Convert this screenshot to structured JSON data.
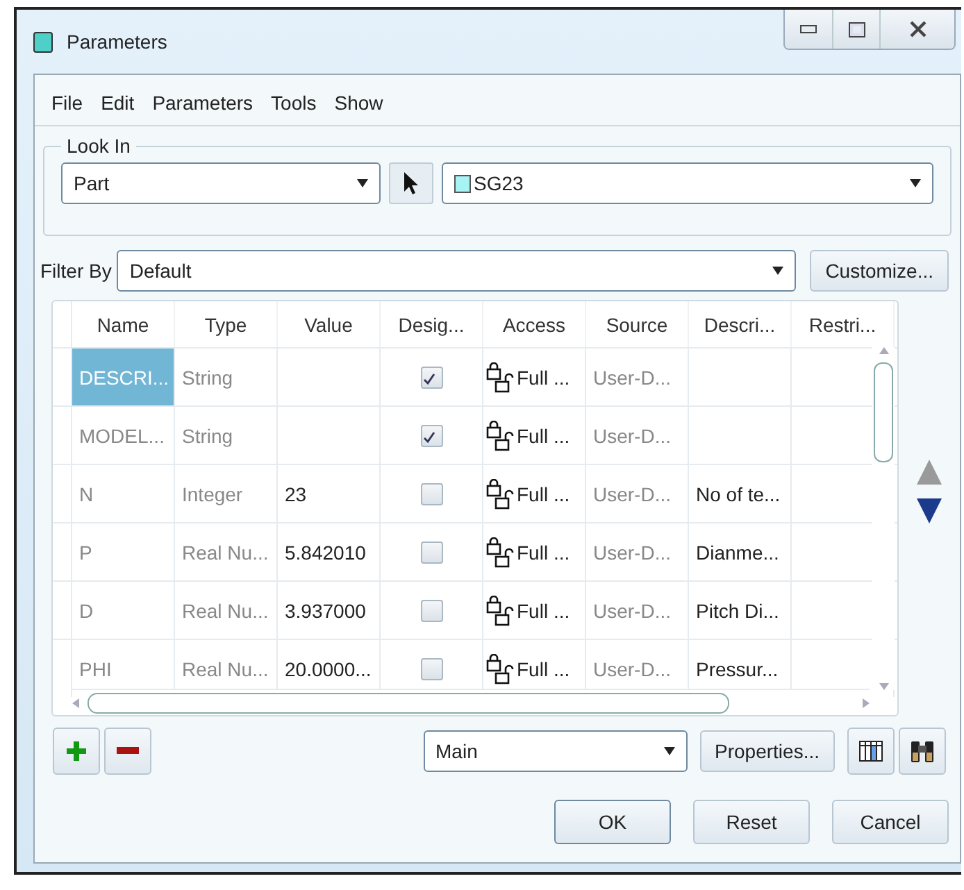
{
  "window": {
    "title": "Parameters"
  },
  "menu": [
    "File",
    "Edit",
    "Parameters",
    "Tools",
    "Show"
  ],
  "look_in": {
    "label": "Look In",
    "type_value": "Part",
    "object_value": "SG23"
  },
  "filter": {
    "label": "Filter By",
    "value": "Default",
    "button": "Customize..."
  },
  "table": {
    "columns": [
      "Name",
      "Type",
      "Value",
      "Desig...",
      "Access",
      "Source",
      "Descri...",
      "Restri..."
    ],
    "rows": [
      {
        "name": "DESCRI...",
        "type": "String",
        "value": "",
        "designate": true,
        "access": "Full ...",
        "source": "User-D...",
        "description": "",
        "selected": true
      },
      {
        "name": "MODEL...",
        "type": "String",
        "value": "",
        "designate": true,
        "access": "Full ...",
        "source": "User-D...",
        "description": "",
        "selected": false
      },
      {
        "name": "N",
        "type": "Integer",
        "value": "23",
        "designate": false,
        "access": "Full ...",
        "source": "User-D...",
        "description": "No of te...",
        "selected": false
      },
      {
        "name": "P",
        "type": "Real Nu...",
        "value": "5.842010",
        "designate": false,
        "access": "Full ...",
        "source": "User-D...",
        "description": "Dianme...",
        "selected": false
      },
      {
        "name": "D",
        "type": "Real Nu...",
        "value": "3.937000",
        "designate": false,
        "access": "Full ...",
        "source": "User-D...",
        "description": "Pitch Di...",
        "selected": false
      },
      {
        "name": "PHI",
        "type": "Real Nu...",
        "value": "20.0000...",
        "designate": false,
        "access": "Full ...",
        "source": "User-D...",
        "description": "Pressur...",
        "selected": false
      }
    ]
  },
  "bottom": {
    "set_value": "Main",
    "properties_button": "Properties..."
  },
  "buttons": [
    "OK",
    "Reset",
    "Cancel"
  ]
}
